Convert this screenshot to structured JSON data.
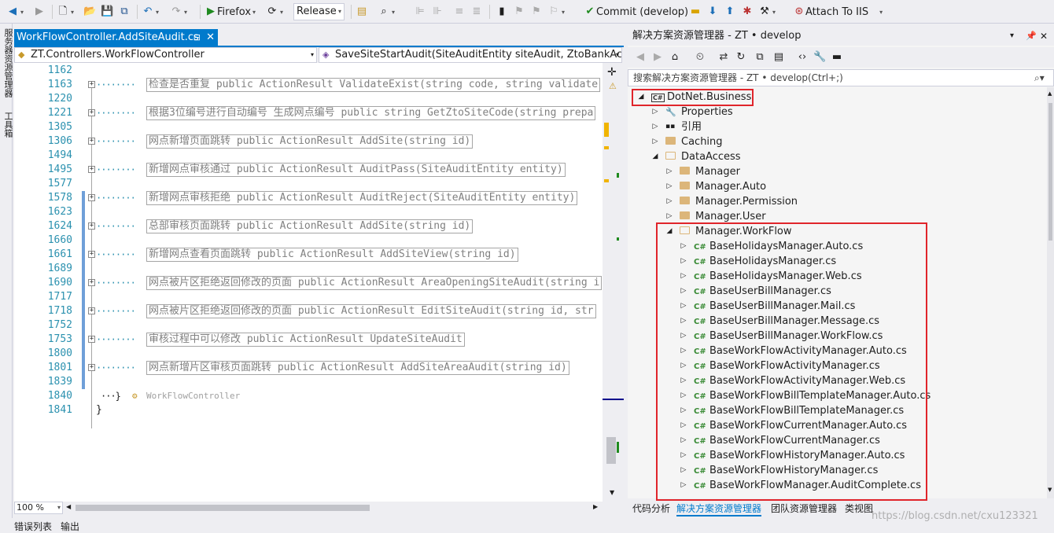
{
  "toolbar": {
    "browser": "Firefox",
    "config": "Release",
    "commit": "Commit (develop)",
    "attach": "Attach To IIS"
  },
  "left_strip": {
    "items": [
      "服务器资源管理器",
      "工具箱"
    ]
  },
  "editor": {
    "tab_title": "WorkFlowController.AddSiteAudit.cs",
    "nav_class": "ZT.Controllers.WorkFlowController",
    "nav_member": "SaveSiteStartAudit(SiteAuditEntity siteAudit, ZtoBankAccountA",
    "zoom": "100 %",
    "lines": [
      {
        "num": "1162",
        "text": ""
      },
      {
        "num": "1163",
        "text": "检查是否重复 public ActionResult ValidateExist(string code, string validate"
      },
      {
        "num": "1220",
        "text": ""
      },
      {
        "num": "1221",
        "text": "根据3位编号进行自动编号 生成网点编号  public string GetZtoSiteCode(string prepa"
      },
      {
        "num": "1305",
        "text": ""
      },
      {
        "num": "1306",
        "text": "网点新增页面跳转 public ActionResult AddSite(string id)"
      },
      {
        "num": "1494",
        "text": ""
      },
      {
        "num": "1495",
        "text": "新增网点审核通过 public ActionResult AuditPass(SiteAuditEntity entity)"
      },
      {
        "num": "1577",
        "text": ""
      },
      {
        "num": "1578",
        "text": "新增网点审核拒绝 public ActionResult AuditReject(SiteAuditEntity entity)"
      },
      {
        "num": "1623",
        "text": ""
      },
      {
        "num": "1624",
        "text": "总部审核页面跳转 public ActionResult AddSite(string id)"
      },
      {
        "num": "1660",
        "text": ""
      },
      {
        "num": "1661",
        "text": "新增网点查看页面跳转 public ActionResult AddSiteView(string id)"
      },
      {
        "num": "1689",
        "text": ""
      },
      {
        "num": "1690",
        "text": "网点被片区拒绝返回修改的页面 public ActionResult AreaOpeningSiteAudit(string i"
      },
      {
        "num": "1717",
        "text": ""
      },
      {
        "num": "1718",
        "text": "网点被片区拒绝返回修改的页面  public ActionResult EditSiteAudit(string id, str"
      },
      {
        "num": "1752",
        "text": ""
      },
      {
        "num": "1753",
        "text": "审核过程中可以修改  public ActionResult UpdateSiteAudit"
      },
      {
        "num": "1800",
        "text": ""
      },
      {
        "num": "1801",
        "text": "网点新增片区审核页面跳转 public ActionResult AddSiteAreaAudit(string id)"
      },
      {
        "num": "1839",
        "text": ""
      },
      {
        "num": "1840",
        "text": ""
      },
      {
        "num": "1841",
        "text": ""
      }
    ],
    "end_class_label": "WorkFlowController"
  },
  "solution": {
    "title": "解决方案资源管理器 - ZT • develop",
    "search_placeholder": "搜索解决方案资源管理器 - ZT • develop(Ctrl+;)",
    "nodes": [
      {
        "label": "DotNet.Business",
        "kind": "project",
        "level": 0,
        "expanded": true
      },
      {
        "label": "Properties",
        "kind": "wrench",
        "level": 1,
        "expanded": false
      },
      {
        "label": "引用",
        "kind": "ref",
        "level": 1,
        "expanded": false
      },
      {
        "label": "Caching",
        "kind": "folder",
        "level": 1,
        "expanded": false
      },
      {
        "label": "DataAccess",
        "kind": "folder-open",
        "level": 1,
        "expanded": true
      },
      {
        "label": "Manager",
        "kind": "folder",
        "level": 2,
        "expanded": false
      },
      {
        "label": "Manager.Auto",
        "kind": "folder",
        "level": 2,
        "expanded": false
      },
      {
        "label": "Manager.Permission",
        "kind": "folder",
        "level": 2,
        "expanded": false
      },
      {
        "label": "Manager.User",
        "kind": "folder",
        "level": 2,
        "expanded": false
      },
      {
        "label": "Manager.WorkFlow",
        "kind": "folder-open",
        "level": 2,
        "expanded": true
      },
      {
        "label": "BaseHolidaysManager.Auto.cs",
        "kind": "cs",
        "level": 3
      },
      {
        "label": "BaseHolidaysManager.cs",
        "kind": "cs",
        "level": 3
      },
      {
        "label": "BaseHolidaysManager.Web.cs",
        "kind": "cs",
        "level": 3
      },
      {
        "label": "BaseUserBillManager.cs",
        "kind": "cs",
        "level": 3
      },
      {
        "label": "BaseUserBillManager.Mail.cs",
        "kind": "cs",
        "level": 3
      },
      {
        "label": "BaseUserBillManager.Message.cs",
        "kind": "cs",
        "level": 3
      },
      {
        "label": "BaseUserBillManager.WorkFlow.cs",
        "kind": "cs",
        "level": 3
      },
      {
        "label": "BaseWorkFlowActivityManager.Auto.cs",
        "kind": "cs",
        "level": 3
      },
      {
        "label": "BaseWorkFlowActivityManager.cs",
        "kind": "cs",
        "level": 3
      },
      {
        "label": "BaseWorkFlowActivityManager.Web.cs",
        "kind": "cs",
        "level": 3
      },
      {
        "label": "BaseWorkFlowBillTemplateManager.Auto.cs",
        "kind": "cs",
        "level": 3
      },
      {
        "label": "BaseWorkFlowBillTemplateManager.cs",
        "kind": "cs",
        "level": 3
      },
      {
        "label": "BaseWorkFlowCurrentManager.Auto.cs",
        "kind": "cs",
        "level": 3
      },
      {
        "label": "BaseWorkFlowCurrentManager.cs",
        "kind": "cs",
        "level": 3
      },
      {
        "label": "BaseWorkFlowHistoryManager.Auto.cs",
        "kind": "cs",
        "level": 3
      },
      {
        "label": "BaseWorkFlowHistoryManager.cs",
        "kind": "cs",
        "level": 3
      },
      {
        "label": "BaseWorkFlowManager.AuditComplete.cs",
        "kind": "cs",
        "level": 3
      }
    ],
    "bottom_tabs": [
      "代码分析",
      "解决方案资源管理器",
      "团队资源管理器",
      "类视图"
    ]
  },
  "status": {
    "items": [
      "错误列表",
      "输出"
    ],
    "watermark": "https://blog.csdn.net/cxu123321"
  },
  "colors": {
    "accent": "#007acc",
    "highlight": "#e0252b",
    "csharp": "#388a34"
  }
}
